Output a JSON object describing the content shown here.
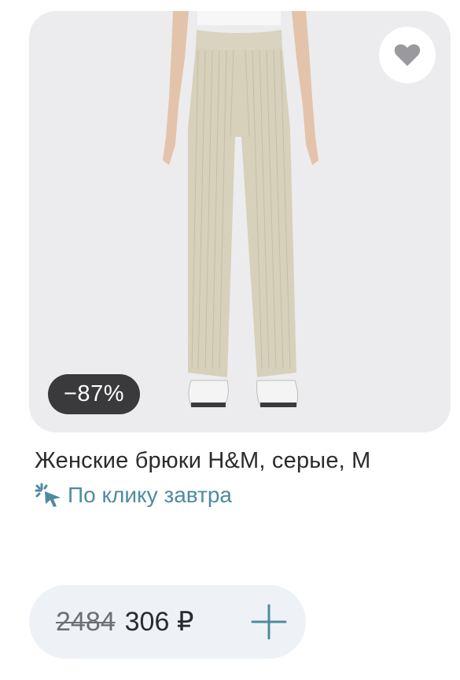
{
  "product": {
    "title": "Женские брюки H&M, серые, M",
    "discount_badge": "−87%",
    "delivery_text": "По клику завтра",
    "old_price": "2484",
    "new_price": "306 ₽"
  },
  "icons": {
    "favorite": "heart-icon",
    "delivery": "sparkle-cursor-icon",
    "add": "plus-icon"
  },
  "colors": {
    "image_bg": "#ececee",
    "badge_bg": "#3a3a3c",
    "delivery_accent": "#4f8aa1",
    "price_pill_bg": "#eef2f6"
  }
}
